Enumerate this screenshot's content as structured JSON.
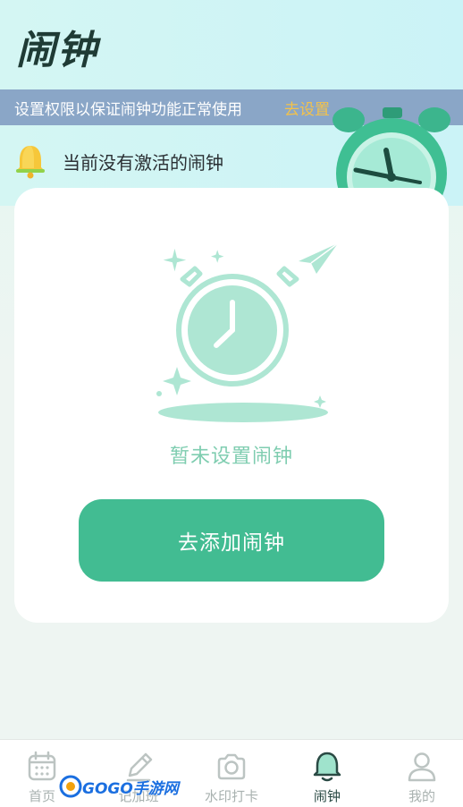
{
  "header": {
    "title": "闹钟"
  },
  "permission_bar": {
    "message": "设置权限以保证闹钟功能正常使用",
    "action": "去设置"
  },
  "status": {
    "text": "当前没有激活的闹钟"
  },
  "empty_state": {
    "text": "暂未设置闹钟",
    "button_label": "去添加闹钟"
  },
  "tabbar": {
    "tabs": [
      {
        "label": "首页",
        "icon": "calendar-icon",
        "active": false
      },
      {
        "label": "记加班",
        "icon": "pencil-icon",
        "active": false
      },
      {
        "label": "水印打卡",
        "icon": "camera-icon",
        "active": false
      },
      {
        "label": "闹钟",
        "icon": "bell-icon",
        "active": true
      },
      {
        "label": "我的",
        "icon": "user-icon",
        "active": false
      }
    ]
  },
  "watermark": {
    "text": "GOGO手游网"
  },
  "colors": {
    "accent": "#42bc92",
    "permission_bar": "#8aa6c7",
    "link": "#f3c24b",
    "illustration": "#aee6d3"
  }
}
